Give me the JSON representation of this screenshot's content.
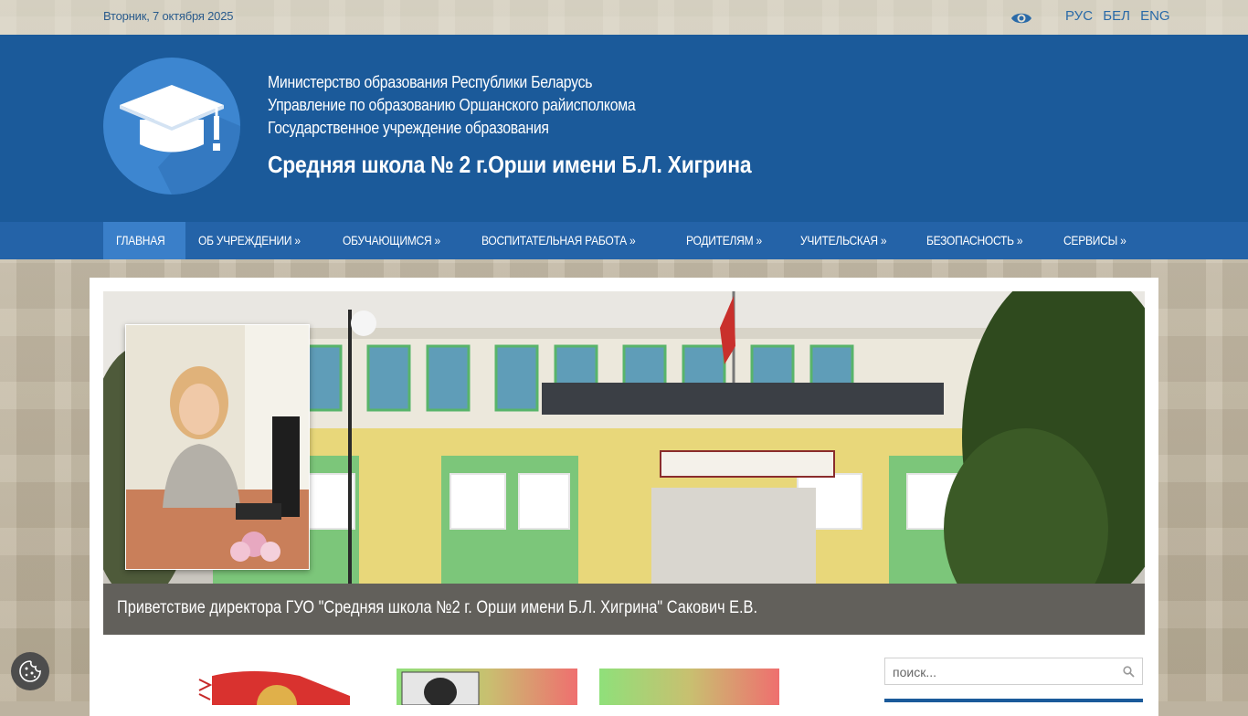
{
  "topbar": {
    "date": "Вторник, 7 октября 2025",
    "languages": [
      "РУС",
      "БЕЛ",
      "ENG"
    ],
    "accessibility_icon": "eye-icon"
  },
  "header": {
    "line1": "Министерство образования Республики Беларусь",
    "line2": "Управление по образованию Оршанского райисполкома",
    "line3": "Государственное учреждение образования",
    "title": "Средняя школа № 2 г.Орши имени Б.Л. Хигрина",
    "logo_icon": "graduation-cap-icon"
  },
  "nav": {
    "items": [
      {
        "label": "ГЛАВНАЯ"
      },
      {
        "label": "ОБ УЧРЕЖДЕНИИ  »"
      },
      {
        "label": "ОБУЧАЮЩИМСЯ  »"
      },
      {
        "label": "ВОСПИТАТЕЛЬНАЯ РАБОТА  »"
      },
      {
        "label": "РОДИТЕЛЯМ  »"
      },
      {
        "label": "УЧИТЕЛЬСКАЯ  »"
      },
      {
        "label": "БЕЗОПАСНОСТЬ  »"
      },
      {
        "label": "СЕРВИСЫ  »"
      }
    ]
  },
  "slider": {
    "caption": "Приветствие директора ГУО \"Средняя школа №2 г. Орши имени Б.Л. Хигрина\" Сакович Е.В."
  },
  "search": {
    "placeholder": "поиск..."
  },
  "colors": {
    "header_blue": "#1b5a9a",
    "nav_blue": "#2463a8",
    "nav_active": "#3a7fc9"
  }
}
